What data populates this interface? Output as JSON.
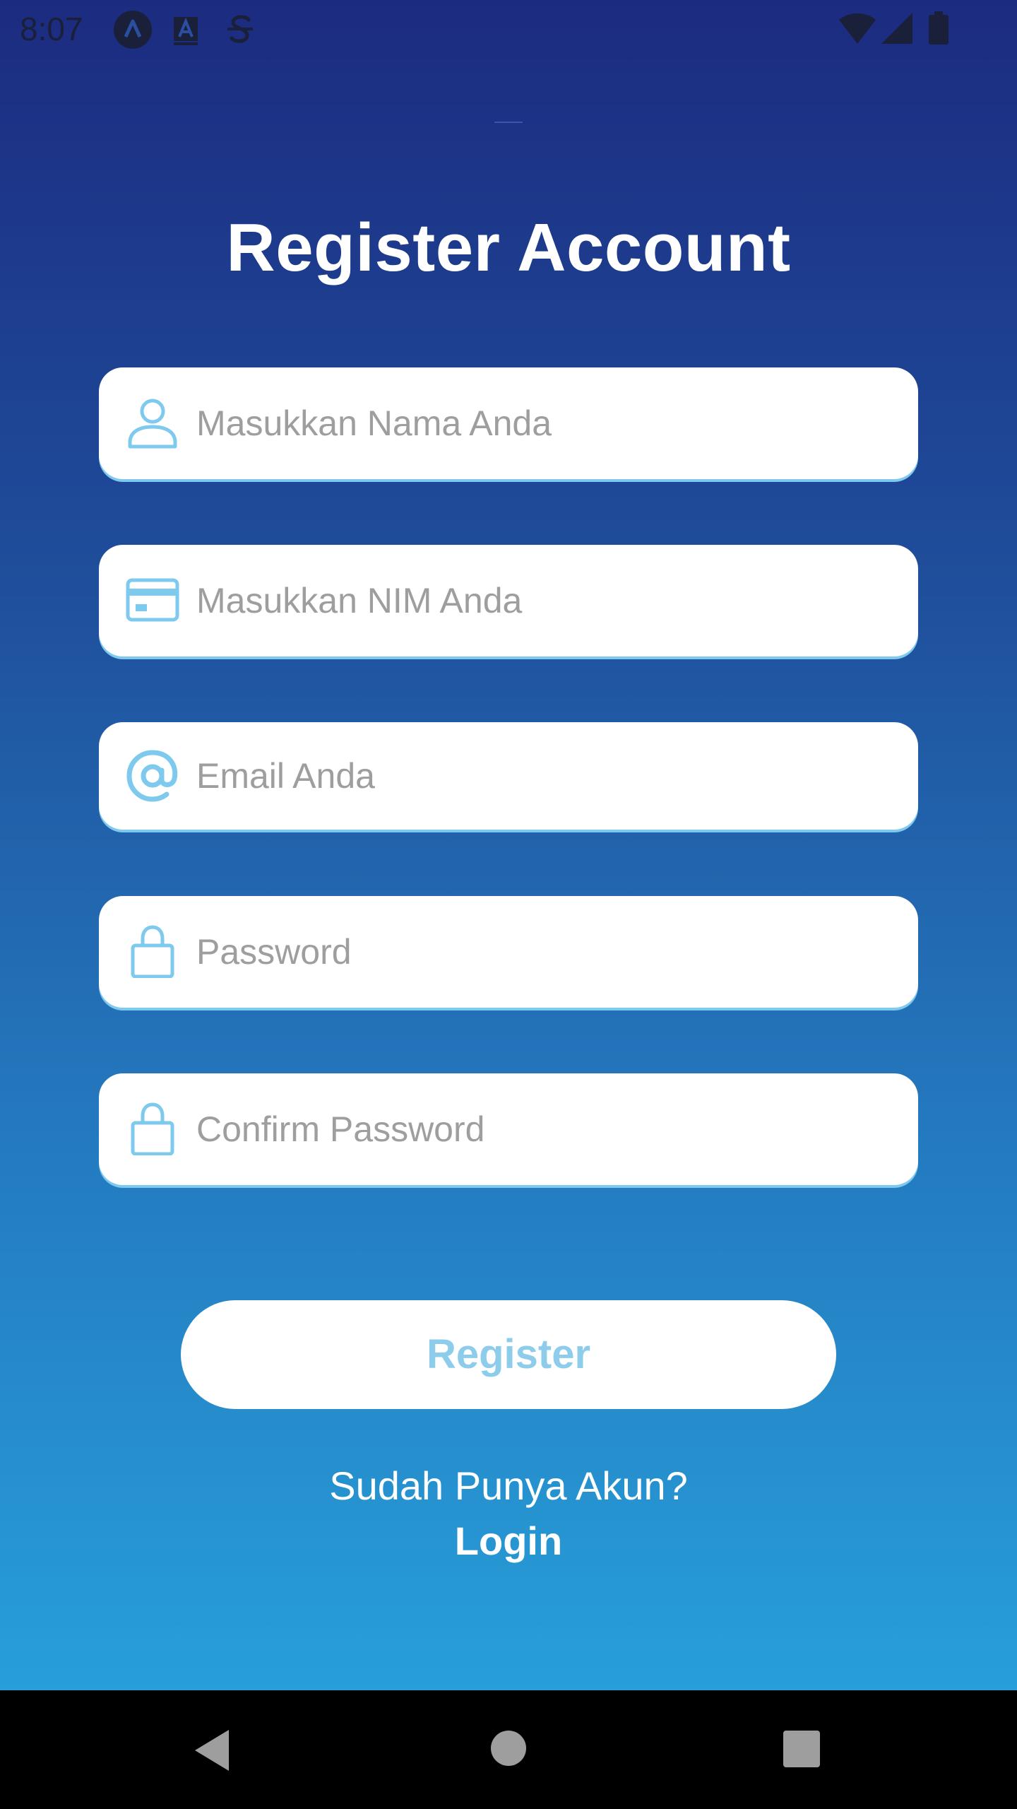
{
  "status_bar": {
    "time": "8:07",
    "left_icons": [
      "a-circle-icon",
      "a-box-icon",
      "s-strike-icon"
    ],
    "right_icons": [
      "wifi-icon",
      "signal-icon",
      "battery-icon"
    ]
  },
  "page": {
    "title": "Register Account"
  },
  "form": {
    "fields": [
      {
        "name": "name",
        "icon": "person-icon",
        "placeholder": "Masukkan Nama Anda",
        "value": ""
      },
      {
        "name": "nim",
        "icon": "id-card-icon",
        "placeholder": "Masukkan NIM Anda",
        "value": ""
      },
      {
        "name": "email",
        "icon": "at-icon",
        "placeholder": "Email Anda",
        "value": ""
      },
      {
        "name": "password",
        "icon": "lock-icon",
        "placeholder": "Password",
        "value": ""
      },
      {
        "name": "confirm_password",
        "icon": "lock-icon",
        "placeholder": "Confirm Password",
        "value": ""
      }
    ],
    "register_label": "Register",
    "have_account_text": "Sudah Punya Akun?",
    "login_label": "Login"
  },
  "nav_bar": {
    "icons": [
      "back-icon",
      "home-icon",
      "recents-icon"
    ]
  },
  "colors": {
    "gradient_top": "#1c2b80",
    "gradient_bottom": "#279fd9",
    "accent": "#8dcdeb",
    "icon": "#7ec9ee"
  }
}
